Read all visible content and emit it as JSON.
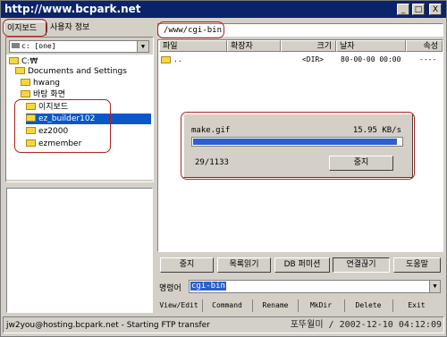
{
  "window": {
    "title": "http://www.bcpark.net",
    "buttons": [
      "_",
      "□",
      "X"
    ]
  },
  "left": {
    "tabs": [
      "이지보드",
      "사용자 정보"
    ],
    "drive": "c: [one]",
    "tree": [
      {
        "label": "C:₩"
      },
      {
        "label": "Documents and Settings"
      },
      {
        "label": "hwang"
      },
      {
        "label": "바탕 화면"
      },
      {
        "label": "이지보드"
      },
      {
        "label": "ez_builder102"
      },
      {
        "label": "ez2000"
      },
      {
        "label": "ezmember"
      }
    ]
  },
  "right": {
    "path": "/www/cgi-bin",
    "columns": [
      "파일",
      "확장자",
      "크기",
      "날자",
      "속성"
    ],
    "rows": [
      {
        "name": "..",
        "ext": "",
        "size": "<DIR>",
        "date": "80-00-00 00:00",
        "attr": "----"
      }
    ]
  },
  "transfer": {
    "file": "make.gif",
    "speed": "15.95 KB/s",
    "progress": "29/1133",
    "fraction": 0.98,
    "stop": "중지"
  },
  "buttons": [
    "중지",
    "목록읽기",
    "DB 퍼미션",
    "연결끊기",
    "도움말"
  ],
  "command": {
    "label": "명령어",
    "value": "cgi-bin"
  },
  "toolbar": [
    "View/Edit",
    "Command",
    "Rename",
    "MkDir",
    "Delete",
    "Exit"
  ],
  "status": {
    "message": "jw2you@hosting.bcpark.net - Starting FTP transfer",
    "stamp": "포뚜월미 / 2002-12-10 04:12:09"
  },
  "colors": {
    "title_bar": "#0a246a",
    "selection": "#0a58c8",
    "highlight_outline": "#b32020",
    "progress": "#2c5fcf"
  }
}
